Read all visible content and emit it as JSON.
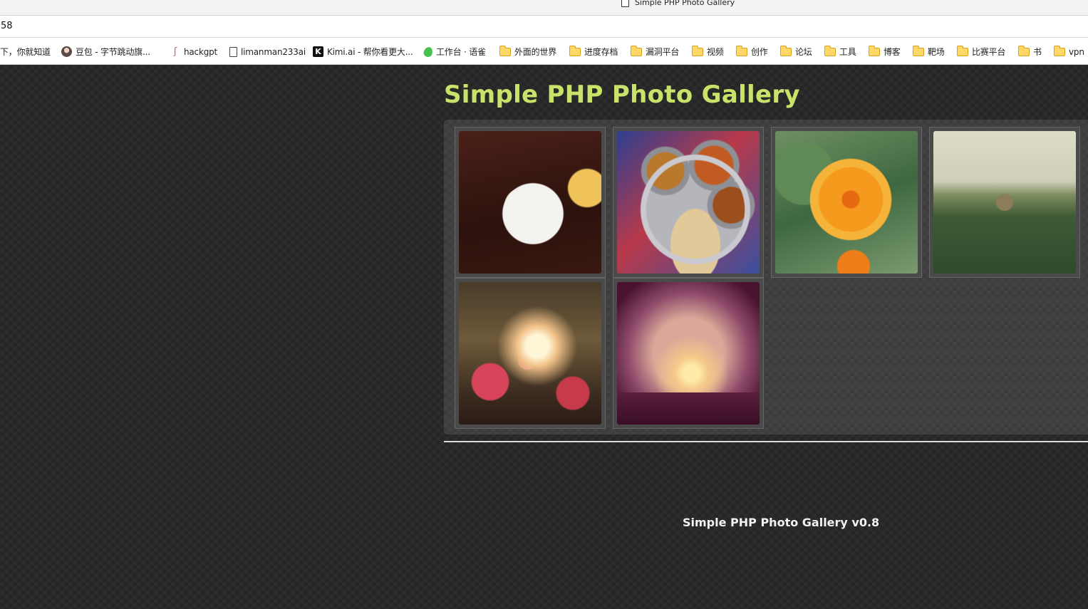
{
  "browser": {
    "tab_title": "Simple PHP Photo Gallery",
    "address": "58"
  },
  "bookmarks": [
    {
      "label": "下，你就知道",
      "icon": "none"
    },
    {
      "label": "豆包 - 字节跳动旗...",
      "icon": "avatar-icon"
    },
    {
      "label": "hackgpt",
      "icon": "feather-icon"
    },
    {
      "label": "limanman233ai",
      "icon": "page-icon"
    },
    {
      "label": "Kimi.ai - 帮你看更大...",
      "icon": "kimi-icon"
    },
    {
      "label": "工作台 · 语雀",
      "icon": "drop-icon"
    },
    {
      "label": "外面的世界",
      "icon": "folder-icon"
    },
    {
      "label": "进度存档",
      "icon": "folder-icon"
    },
    {
      "label": "漏洞平台",
      "icon": "folder-icon"
    },
    {
      "label": "视频",
      "icon": "folder-icon"
    },
    {
      "label": "创作",
      "icon": "folder-icon"
    },
    {
      "label": "论坛",
      "icon": "folder-icon"
    },
    {
      "label": "工具",
      "icon": "folder-icon"
    },
    {
      "label": "博客",
      "icon": "folder-icon"
    },
    {
      "label": "靶场",
      "icon": "folder-icon"
    },
    {
      "label": "比赛平台",
      "icon": "folder-icon"
    },
    {
      "label": "书",
      "icon": "folder-icon"
    },
    {
      "label": "vpn",
      "icon": "folder-icon"
    }
  ],
  "gallery": {
    "title": "Simple PHP Photo Gallery",
    "photos": [
      {
        "name": "breakfast-photo"
      },
      {
        "name": "thali-photo"
      },
      {
        "name": "orange-flower-photo"
      },
      {
        "name": "fountain-photo"
      },
      {
        "name": "blossoms-photo"
      },
      {
        "name": "sunset-photo"
      }
    ]
  },
  "footer": {
    "text": "Simple PHP Photo Gallery v0.8"
  },
  "colors": {
    "title": "#c9e36a",
    "background": "#262626",
    "panel": "#3d3d3d"
  }
}
